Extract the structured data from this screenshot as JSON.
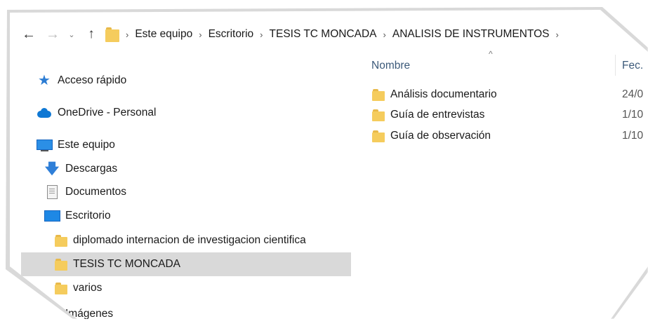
{
  "address_bar": {
    "breadcrumbs": [
      "Este equipo",
      "Escritorio",
      "TESIS TC MONCADA",
      "ANALISIS DE INSTRUMENTOS"
    ],
    "trailing_chevron": "›"
  },
  "sidebar": {
    "items": [
      {
        "label": "Acceso rápido",
        "icon": "star-icon"
      },
      {
        "label": "OneDrive - Personal",
        "icon": "cloud-icon"
      },
      {
        "label": "Este equipo",
        "icon": "computer-icon"
      },
      {
        "label": "Descargas",
        "icon": "download-icon"
      },
      {
        "label": "Documentos",
        "icon": "document-icon"
      },
      {
        "label": "Escritorio",
        "icon": "desktop-icon"
      },
      {
        "label": "diplomado internacion de investigacion cientifica",
        "icon": "folder-icon"
      },
      {
        "label": "TESIS TC MONCADA",
        "icon": "folder-icon",
        "selected": true
      },
      {
        "label": "varios",
        "icon": "folder-icon"
      },
      {
        "label": "Imágenes",
        "icon": "pictures-icon"
      }
    ]
  },
  "content": {
    "columns": {
      "name": "Nombre",
      "date": "Fec."
    },
    "sort_indicator": "^",
    "rows": [
      {
        "name": "Análisis documentario",
        "date": "24/0"
      },
      {
        "name": "Guía de entrevistas",
        "date": "1/10"
      },
      {
        "name": "Guía de observación",
        "date": "1/10"
      }
    ]
  },
  "colors": {
    "selection": "#d9d9d9",
    "folder": "#f5cc5d",
    "accent": "#0f78d4"
  }
}
